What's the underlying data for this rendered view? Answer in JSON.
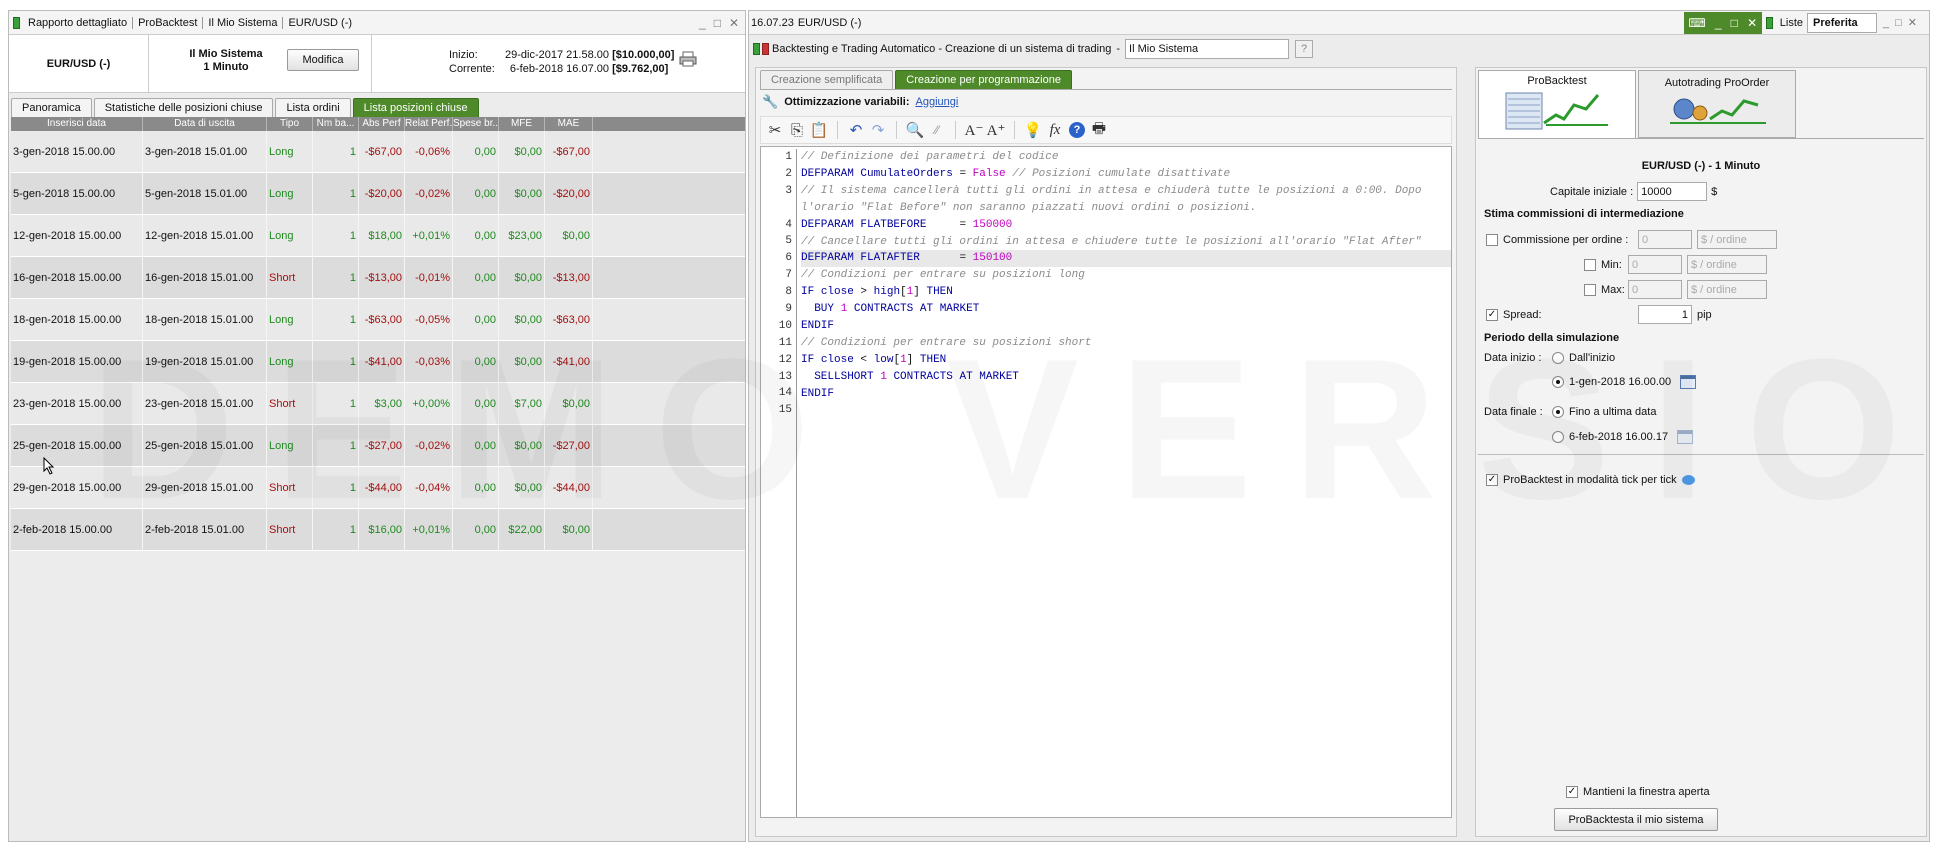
{
  "left": {
    "title_segments": [
      "Rapporto dettagliato",
      "ProBacktest",
      "Il Mio Sistema",
      "EUR/USD (-)"
    ],
    "instrument": "EUR/USD (-)",
    "system_name": "Il Mio Sistema",
    "timeframe": "1 Minuto",
    "modify_label": "Modifica",
    "start_label": "Inizio:",
    "start_date": "29-dic-2017 21.58.00",
    "start_capital": "[$10.000,00]",
    "current_label": "Corrente:",
    "current_date": "6-feb-2018 16.07.00",
    "current_capital": "[$9.762,00]",
    "tabs": [
      "Panoramica",
      "Statistiche delle posizioni chiuse",
      "Lista ordini",
      "Lista posizioni chiuse"
    ],
    "columns": [
      "Inserisci data",
      "Data di uscita",
      "Tipo",
      "Nm ba...",
      "Abs Perf",
      "Relat Perf...",
      "Spese br...",
      "MFE",
      "MAE"
    ],
    "rows": [
      [
        "3-gen-2018 15.00.00",
        "3-gen-2018 15.01.00",
        "Long",
        "1",
        "-$67,00",
        "-0,06%",
        "0,00",
        "$0,00",
        "-$67,00"
      ],
      [
        "5-gen-2018 15.00.00",
        "5-gen-2018 15.01.00",
        "Long",
        "1",
        "-$20,00",
        "-0,02%",
        "0,00",
        "$0,00",
        "-$20,00"
      ],
      [
        "12-gen-2018 15.00.00",
        "12-gen-2018 15.01.00",
        "Long",
        "1",
        "$18,00",
        "+0,01%",
        "0,00",
        "$23,00",
        "$0,00"
      ],
      [
        "16-gen-2018 15.00.00",
        "16-gen-2018 15.01.00",
        "Short",
        "1",
        "-$13,00",
        "-0,01%",
        "0,00",
        "$0,00",
        "-$13,00"
      ],
      [
        "18-gen-2018 15.00.00",
        "18-gen-2018 15.01.00",
        "Long",
        "1",
        "-$63,00",
        "-0,05%",
        "0,00",
        "$0,00",
        "-$63,00"
      ],
      [
        "19-gen-2018 15.00.00",
        "19-gen-2018 15.01.00",
        "Long",
        "1",
        "-$41,00",
        "-0,03%",
        "0,00",
        "$0,00",
        "-$41,00"
      ],
      [
        "23-gen-2018 15.00.00",
        "23-gen-2018 15.01.00",
        "Short",
        "1",
        "$3,00",
        "+0,00%",
        "0,00",
        "$7,00",
        "$0,00"
      ],
      [
        "25-gen-2018 15.00.00",
        "25-gen-2018 15.01.00",
        "Long",
        "1",
        "-$27,00",
        "-0,02%",
        "0,00",
        "$0,00",
        "-$27,00"
      ],
      [
        "29-gen-2018 15.00.00",
        "29-gen-2018 15.01.00",
        "Short",
        "1",
        "-$44,00",
        "-0,04%",
        "0,00",
        "$0,00",
        "-$44,00"
      ],
      [
        "2-feb-2018 15.00.00",
        "2-feb-2018 15.01.00",
        "Short",
        "1",
        "$16,00",
        "+0,01%",
        "0,00",
        "$22,00",
        "$0,00"
      ]
    ]
  },
  "right": {
    "clock": "16.07.23",
    "instrument": "EUR/USD (-)",
    "lists_label": "Liste",
    "favorites_label": "Preferita",
    "window_title": "Backtesting e Trading Automatico - Creazione di un sistema di trading",
    "separator": "-",
    "system_name_value": "Il Mio Sistema",
    "mode_tabs": [
      "Creazione semplificata",
      "Creazione per programmazione"
    ],
    "opt_label": "Ottimizzazione variabili:",
    "opt_add": "Aggiungi",
    "code_lines": [
      "// Definizione dei parametri del codice",
      "DEFPARAM CumulateOrders = False // Posizioni cumulate disattivate",
      "// Il sistema cancellerà tutti gli ordini in attesa e chiuderà tutte le posizioni a 0:00. Dopo l'orario \"Flat Before\" non saranno piazzati nuovi ordini o posizioni.",
      "DEFPARAM FLATBEFORE     = 150000",
      "// Cancellare tutti gli ordini in attesa e chiudere tutte le posizioni all'orario \"Flat After\"",
      "DEFPARAM FLATAFTER      = 150100",
      "// Condizioni per entrare su posizioni long",
      "IF close > high[1] THEN",
      "  BUY 1 CONTRACTS AT MARKET",
      "ENDIF",
      "// Condizioni per entrare su posizioni short",
      "IF close < low[1] THEN",
      "  SELLSHORT 1 CONTRACTS AT MARKET",
      "ENDIF",
      ""
    ],
    "side_tabs": [
      "ProBacktest",
      "Autotrading ProOrder"
    ],
    "panel": {
      "instrument_tf": "EUR/USD (-) - 1 Minuto",
      "capital_label": "Capitale iniziale :",
      "capital_value": "10000",
      "currency": "$",
      "fees_title": "Stima commissioni di intermediazione",
      "commission_label": "Commissione per ordine :",
      "min_label": "Min:",
      "max_label": "Max:",
      "fee_value": "0",
      "per_order": "$ / ordine",
      "spread_label": "Spread:",
      "spread_value": "1",
      "pip": "pip",
      "period_title": "Periodo della simulazione",
      "start_label": "Data inizio :",
      "from_start": "Dall'inizio",
      "start_date": "1-gen-2018 16.00.00",
      "end_label": "Data finale :",
      "to_last": "Fino a ultima data",
      "end_date": "6-feb-2018 16.00.17",
      "tick_label": "ProBacktest in modalità tick per tick",
      "keep_open": "Mantieni la finestra aperta",
      "run_button": "ProBacktesta il mio sistema"
    }
  },
  "watermark": "DEMO VERSION"
}
